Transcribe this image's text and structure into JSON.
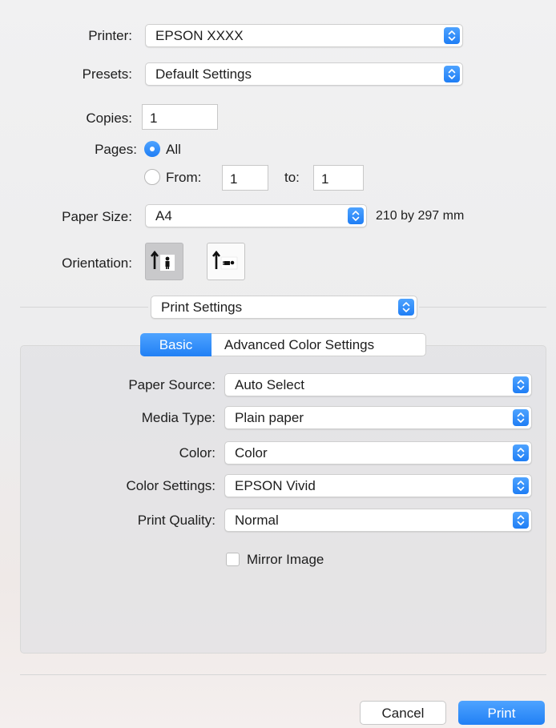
{
  "printer": {
    "label": "Printer:",
    "value": "EPSON XXXX"
  },
  "presets": {
    "label": "Presets:",
    "value": "Default Settings"
  },
  "copies": {
    "label": "Copies:",
    "value": "1"
  },
  "pages": {
    "label": "Pages:",
    "all_label": "All",
    "from_label": "From:",
    "from_value": "1",
    "to_label": "to:",
    "to_value": "1",
    "selected": "All"
  },
  "paper_size": {
    "label": "Paper Size:",
    "value": "A4",
    "dimensions": "210 by 297 mm"
  },
  "orientation": {
    "label": "Orientation:",
    "selected": "portrait"
  },
  "section_popup": {
    "value": "Print Settings"
  },
  "tabs": [
    {
      "label": "Basic",
      "selected": true
    },
    {
      "label": "Advanced Color Settings",
      "selected": false
    }
  ],
  "settings": {
    "paper_source": {
      "label": "Paper Source:",
      "value": "Auto Select"
    },
    "media_type": {
      "label": "Media Type:",
      "value": "Plain paper"
    },
    "color": {
      "label": "Color:",
      "value": "Color"
    },
    "color_settings": {
      "label": "Color Settings:",
      "value": "EPSON Vivid"
    },
    "print_quality": {
      "label": "Print Quality:",
      "value": "Normal"
    },
    "mirror_image": {
      "label": "Mirror Image",
      "checked": false
    }
  },
  "buttons": {
    "cancel": "Cancel",
    "print": "Print"
  },
  "colors": {
    "accent": "#2b87f7",
    "background": "#ececed"
  }
}
